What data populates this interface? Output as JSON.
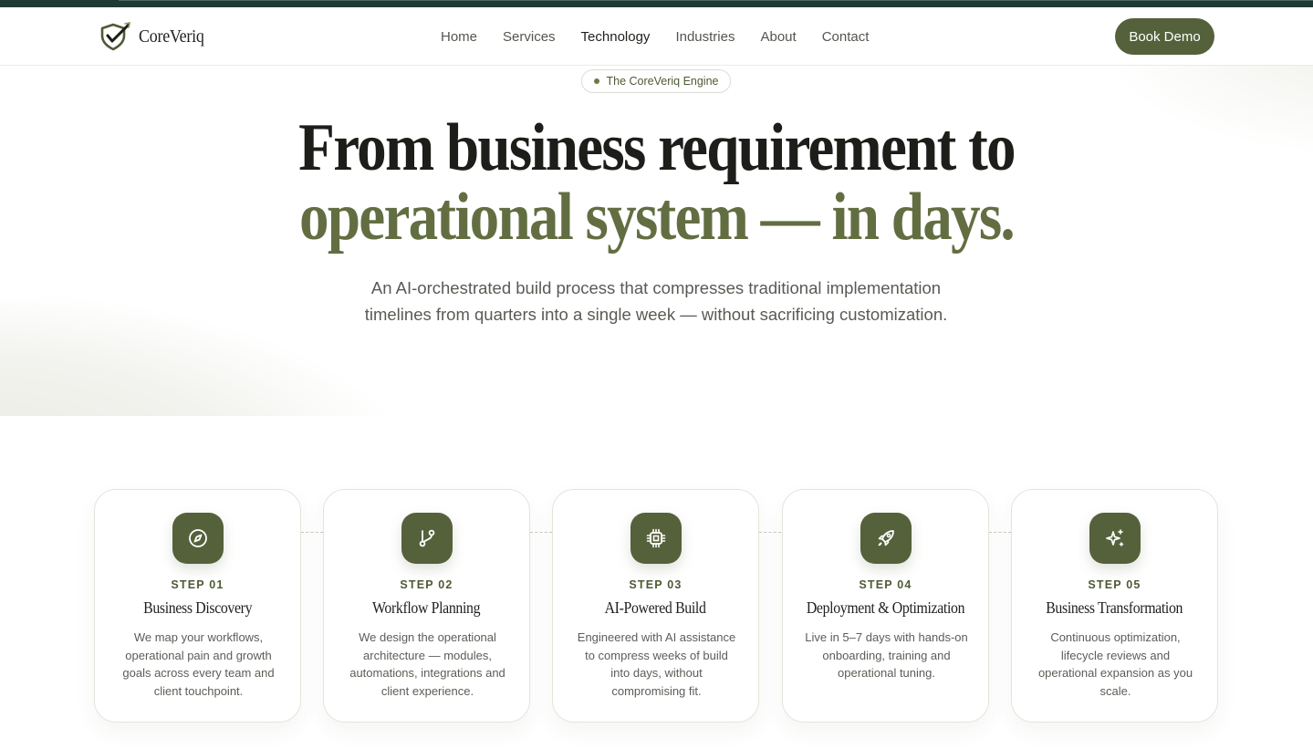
{
  "brand": {
    "name": "CoreVeriq",
    "accent_color": "#55613a"
  },
  "nav": {
    "items": [
      {
        "label": "Home",
        "active": false
      },
      {
        "label": "Services",
        "active": false
      },
      {
        "label": "Technology",
        "active": true
      },
      {
        "label": "Industries",
        "active": false
      },
      {
        "label": "About",
        "active": false
      },
      {
        "label": "Contact",
        "active": false
      }
    ],
    "cta_label": "Book Demo"
  },
  "hero": {
    "badge": "The CoreVeriq Engine",
    "headline_plain": "From business requirement to ",
    "headline_accent": "operational system — in days.",
    "subtitle": "An AI-orchestrated build process that compresses traditional implementation timelines from quarters into a single week — without sacrificing customization."
  },
  "steps": [
    {
      "label": "STEP 01",
      "title": "Business Discovery",
      "description": "We map your workflows, operational pain and growth goals across every team and client touchpoint.",
      "icon": "compass-icon"
    },
    {
      "label": "STEP 02",
      "title": "Workflow Planning",
      "description": "We design the operational architecture — modules, automations, integrations and client experience.",
      "icon": "git-branch-icon"
    },
    {
      "label": "STEP 03",
      "title": "AI-Powered Build",
      "description": "Engineered with AI assistance to compress weeks of build into days, without compromising fit.",
      "icon": "cpu-icon"
    },
    {
      "label": "STEP 04",
      "title": "Deployment & Optimization",
      "description": "Live in 5–7 days with hands-on onboarding, training and operational tuning.",
      "icon": "rocket-icon"
    },
    {
      "label": "STEP 05",
      "title": "Business Transformation",
      "description": "Continuous optimization, lifecycle reviews and operational expansion as you scale.",
      "icon": "sparkles-icon"
    }
  ]
}
